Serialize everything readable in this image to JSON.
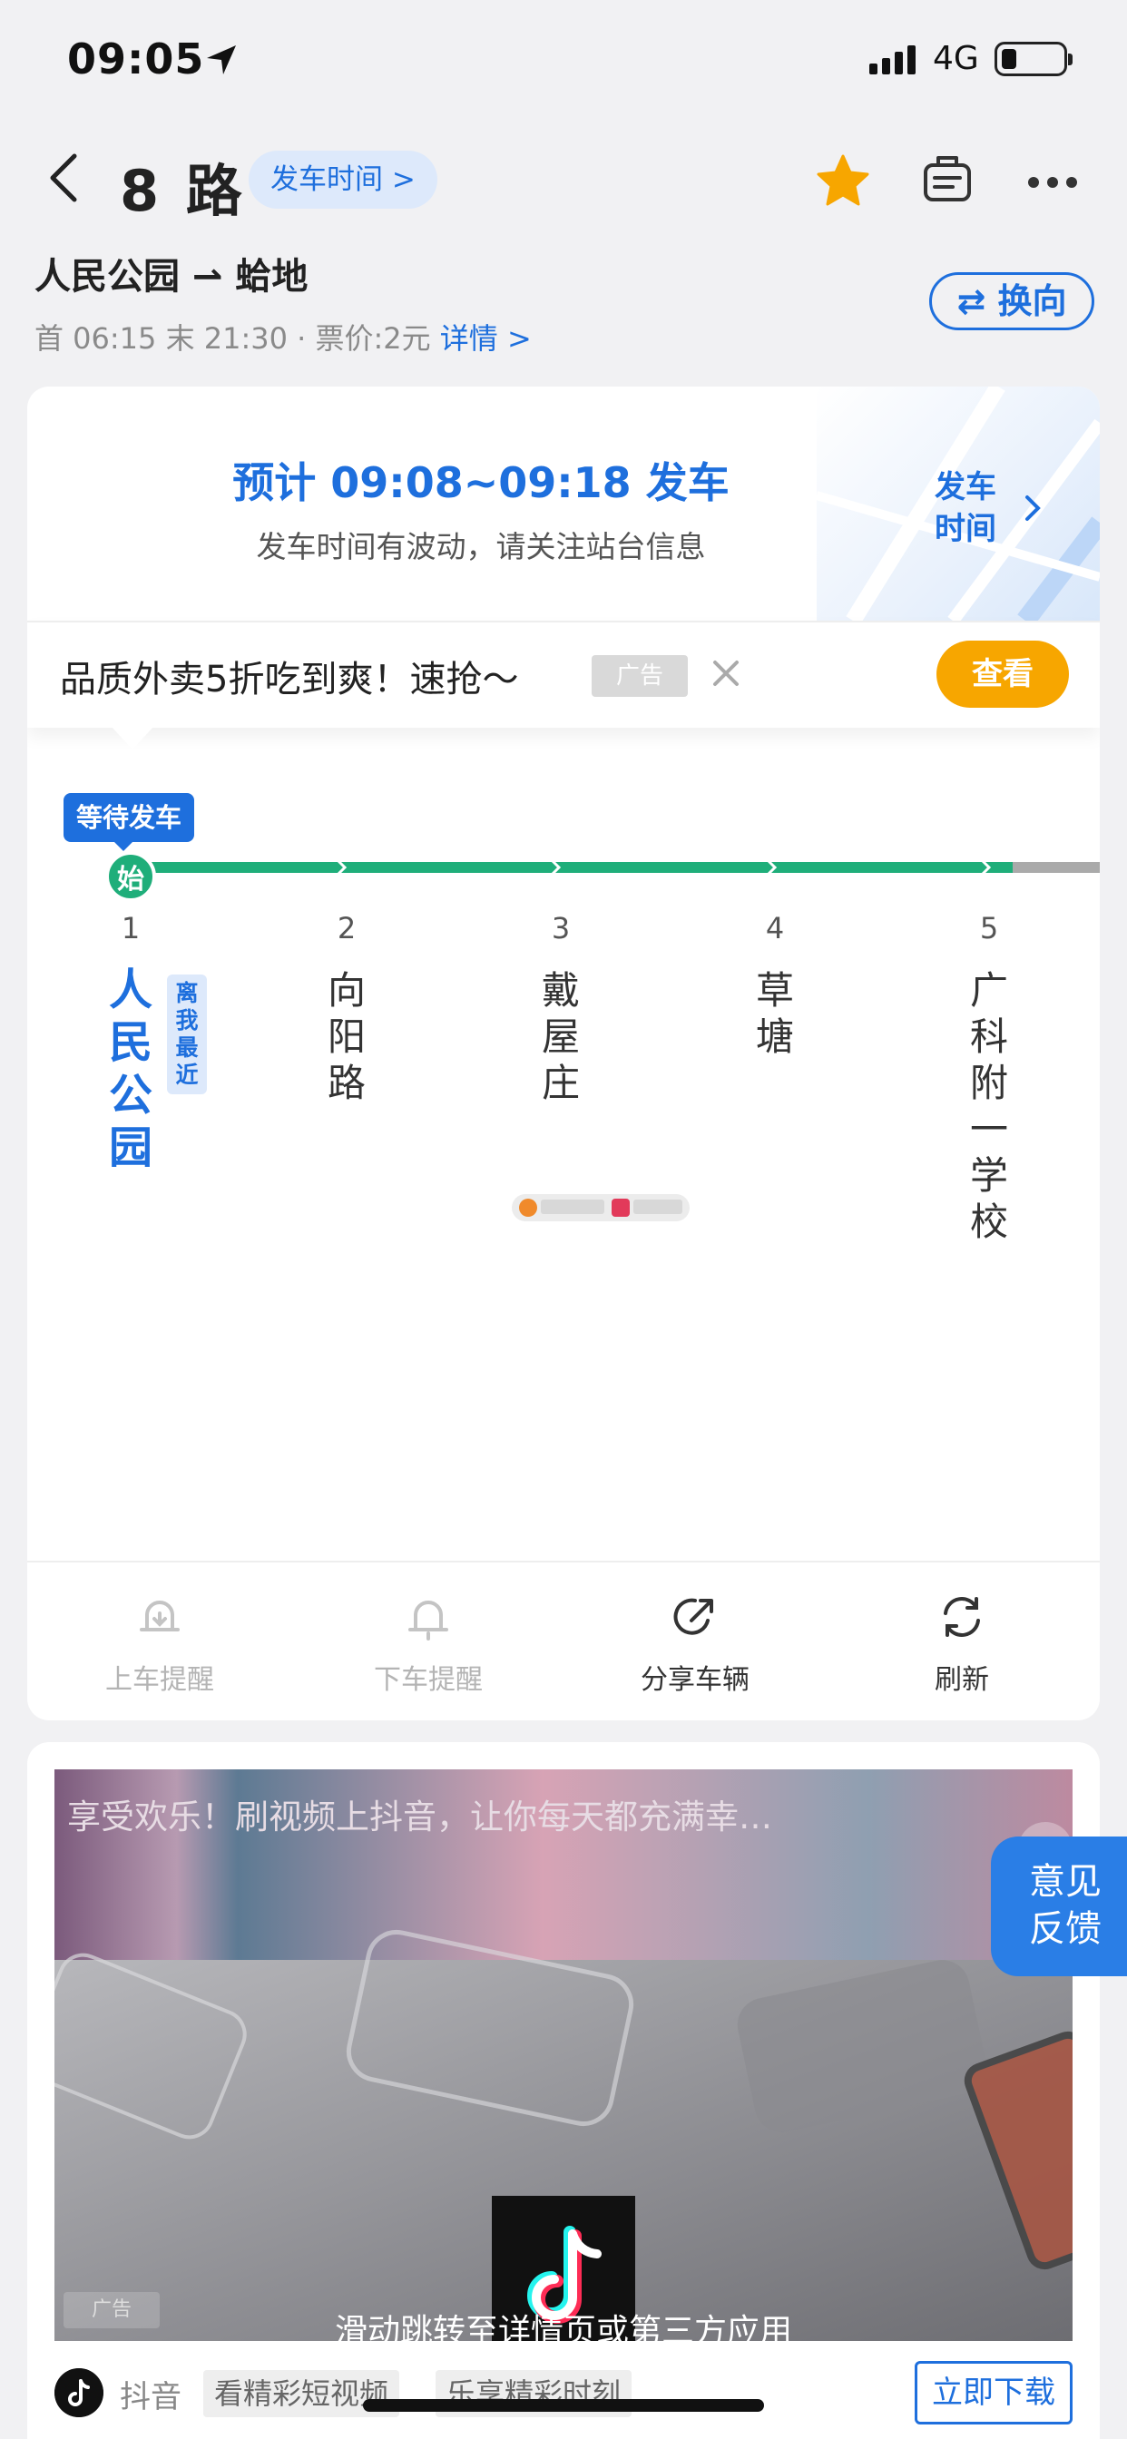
{
  "status_bar": {
    "time": "09:05",
    "network": "4G"
  },
  "header": {
    "title": "8 路",
    "schedule_chip": "发车时间 >",
    "route": "人民公园 ⇀ 蛤地",
    "meta_prefix": "首 06:15 末 21:30 · 票价:2元 ",
    "meta_detail": "详情 >",
    "reverse_button": "⇄ 换向"
  },
  "eta": {
    "main": "预计 09:08~09:18 发车",
    "sub": "发车时间有波动，请关注站台信息",
    "depart_link_1": "发车",
    "depart_link_2": "时间"
  },
  "ad_banner": {
    "text": "品质外卖5折吃到爽！速抢～",
    "tag": "广告",
    "button": "查看"
  },
  "route_map": {
    "wait_badge": "等待发车",
    "start_marker": "始",
    "near_tag": "离我最近",
    "stops": [
      {
        "num": "1",
        "name": "人民公园"
      },
      {
        "num": "2",
        "name": "向阳路"
      },
      {
        "num": "3",
        "name": "戴屋庄"
      },
      {
        "num": "4",
        "name": "草塘"
      },
      {
        "num": "5",
        "name": "广科附一学校"
      }
    ]
  },
  "toolbar": {
    "board_reminder": "上车提醒",
    "alight_reminder": "下车提醒",
    "share": "分享车辆",
    "refresh": "刷新"
  },
  "video_ad": {
    "caption": "享受欢乐！刷视频上抖音，让你每天都充满幸…",
    "hint": "滑动跳转至详情页或第三方应用",
    "ad_mark": "广告",
    "app_name": "抖音",
    "tags": [
      "看精彩短视频",
      "乐享精彩时刻"
    ],
    "download": "立即下载"
  },
  "feedback": {
    "line1": "意见",
    "line2": "反馈"
  },
  "colors": {
    "accent": "#1e6fdd",
    "route_green": "#1fae7a",
    "cta_orange": "#f7a600"
  }
}
